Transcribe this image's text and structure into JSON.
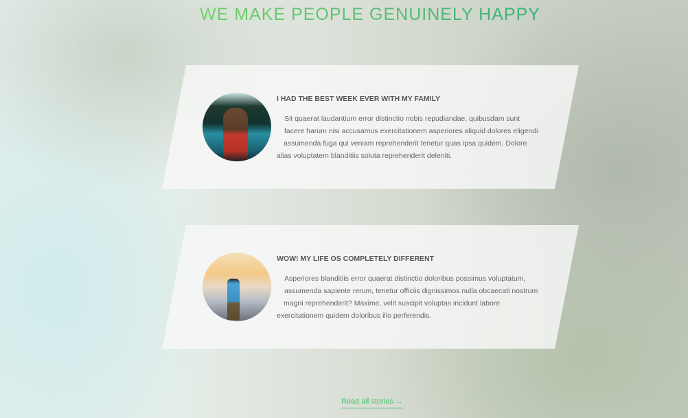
{
  "title": "WE MAKE PEOPLE GENUINELY HAPPY",
  "stories": [
    {
      "heading": "I HAD THE BEST WEEK EVER WITH MY FAMILY",
      "lines": [
        "Sit quaerat laudantium error distinctio nobis repudiandae, quibusdam sunt",
        "facere harum nisi accusamus exercitationem asperiores aliquid dolores eligendi",
        "assumenda fuga qui veniam reprehenderit tenetur quas ipsa quidem. Dolore",
        "alias voluptatem blanditiis soluta reprehenderit deleniti."
      ]
    },
    {
      "heading": "WOW! MY LIFE OS COMPLETELY DIFFERENT",
      "lines": [
        "Asperiores blanditiis error quaerat distinctio doloribus possimus voluptatum,",
        "assumenda sapiente rerum, tenetur officiis dignissimos nulla obcaecati nostrum",
        "magni reprehenderit? Maxime, velit suscipit voluptas incidunt labore",
        "exercitationem quidem doloribus illo perferendis."
      ]
    }
  ],
  "read_all": "Read all stories →",
  "colors": {
    "accent": "#4cbf6a"
  }
}
